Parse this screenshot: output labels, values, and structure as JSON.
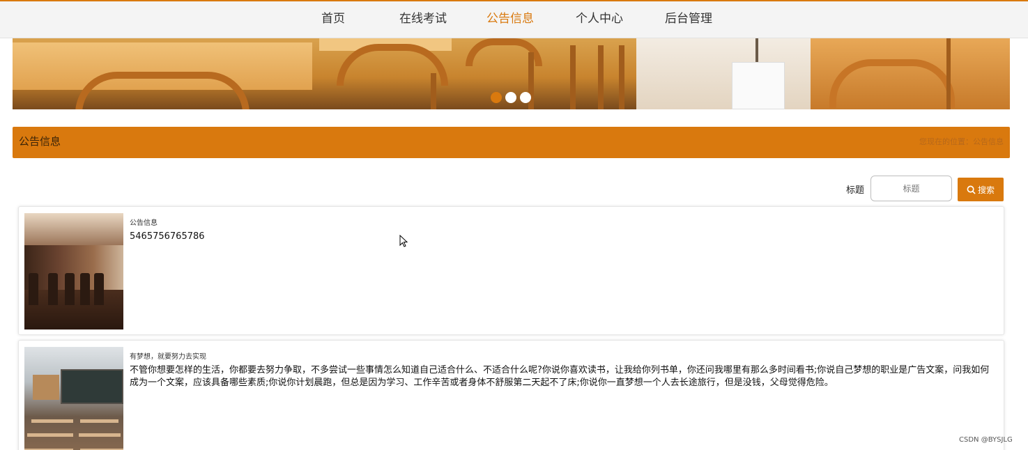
{
  "nav": {
    "items": [
      {
        "label": "首页",
        "active": false
      },
      {
        "label": "在线考试",
        "active": false
      },
      {
        "label": "公告信息",
        "active": true
      },
      {
        "label": "个人中心",
        "active": false
      },
      {
        "label": "后台管理",
        "active": false
      }
    ]
  },
  "carousel": {
    "slide_count": 3,
    "active_index": 0
  },
  "section": {
    "title": "公告信息",
    "breadcrumb": "您现在的位置：公告信息"
  },
  "search": {
    "label": "标题",
    "placeholder": "标题",
    "button_label": "搜索"
  },
  "notices": [
    {
      "subtitle": "公告信息",
      "text": "5465756765786"
    },
    {
      "subtitle": "有梦想，就要努力去实现",
      "text": "不管你想要怎样的生活，你都要去努力争取，不多尝试一些事情怎么知道自己适合什么、不适合什么呢?你说你喜欢读书，让我给你列书单，你还问我哪里有那么多时间看书;你说自己梦想的职业是广告文案，问我如何成为一个文案，应该具备哪些素质;你说你计划晨跑，但总是因为学习、工作辛苦或者身体不舒服第二天起不了床;你说你一直梦想一个人去长途旅行，但是没钱，父母觉得危险。"
    }
  ],
  "watermark": "CSDN @BYSJLG",
  "colors": {
    "accent": "#d9790e",
    "nav_bg": "#f4f4f4"
  }
}
